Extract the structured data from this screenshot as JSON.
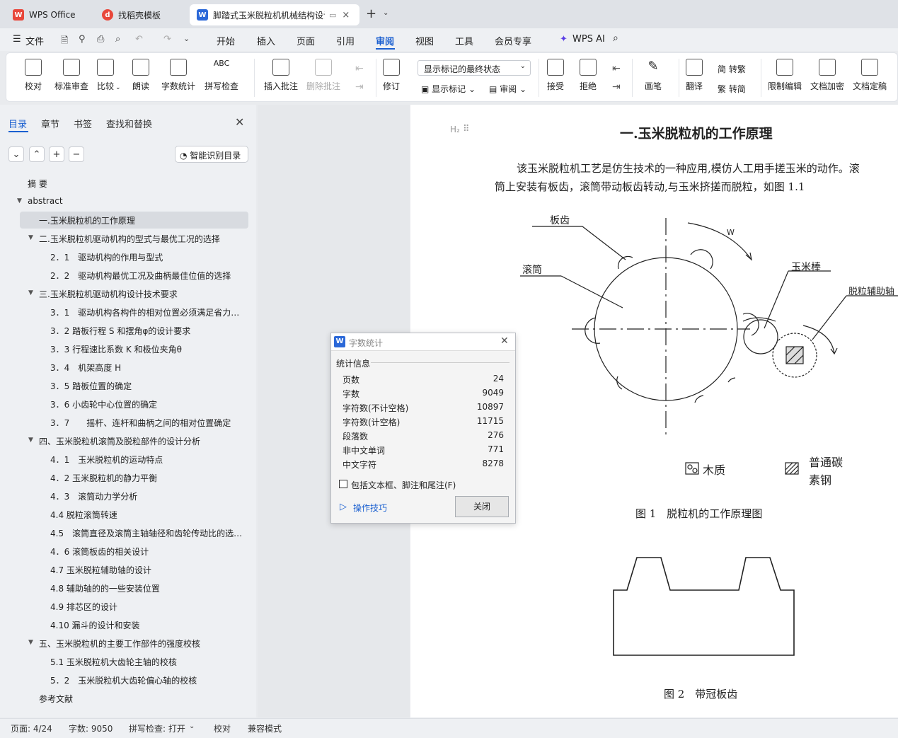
{
  "titlebar": {
    "tabs": [
      {
        "label": "WPS Office"
      },
      {
        "label": "找稻壳模板"
      },
      {
        "label": "脚踏式玉米脱粒机机械结构设计"
      }
    ],
    "new_tab": "+"
  },
  "menubar": {
    "file": "文件",
    "items": [
      "开始",
      "插入",
      "页面",
      "引用",
      "审阅",
      "视图",
      "工具",
      "会员专享"
    ],
    "active": "审阅",
    "ai": "WPS AI"
  },
  "ribbon": {
    "proof": "校对",
    "standard_review": "标准审查",
    "compare": "比较",
    "read_aloud": "朗读",
    "word_count": "字数统计",
    "spell_check": "拼写检查",
    "insert_comment": "插入批注",
    "delete_comment": "删除批注",
    "revise": "修订",
    "markup_state": "显示标记的最终状态",
    "show_markup": "显示标记",
    "review": "审阅",
    "accept": "接受",
    "reject": "拒绝",
    "pen": "画笔",
    "translate": "翻译",
    "to_trad": "简 转繁",
    "to_simp": "繁 转简",
    "restrict_edit": "限制编辑",
    "doc_encrypt": "文档加密",
    "doc_finalize": "文档定稿"
  },
  "navpane": {
    "tabs": [
      "目录",
      "章节",
      "书签",
      "查找和替换"
    ],
    "smart_toc": "智能识别目录",
    "toc": [
      {
        "label": "摘  要",
        "level": 0
      },
      {
        "label": "abstract",
        "level": 0
      },
      {
        "label": "一.玉米脱粒机的工作原理",
        "level": 1
      },
      {
        "label": "二.玉米脱粒机驱动机构的型式与最优工况的选择",
        "level": 1
      },
      {
        "label": "2．1　驱动机构的作用与型式",
        "level": 2
      },
      {
        "label": "2．2　驱动机构最优工况及曲柄最佳位值的选择",
        "level": 2
      },
      {
        "label": "三.玉米脱粒机驱动机构设计技术要求",
        "level": 1
      },
      {
        "label": "3．1　驱动机构各构件的相对位置必须满足省力…",
        "level": 2
      },
      {
        "label": "3．2 踏板行程 S 和摆角φ的设计要求",
        "level": 2
      },
      {
        "label": "3．3 行程速比系数 K 和极位夹角θ",
        "level": 2
      },
      {
        "label": "3．4　机架高度 H",
        "level": 2
      },
      {
        "label": "3．5 踏板位置的确定",
        "level": 2
      },
      {
        "label": "3．6 小齿轮中心位置的确定",
        "level": 2
      },
      {
        "label": "3．7　　摇杆、连杆和曲柄之间的相对位置确定",
        "level": 2
      },
      {
        "label": "四、玉米脱粒机滚筒及脱粒部件的设计分析",
        "level": 1
      },
      {
        "label": "4．1　玉米脱粒机的运动特点",
        "level": 2
      },
      {
        "label": "4．2 玉米脱粒机的静力平衡",
        "level": 2
      },
      {
        "label": "4．3　滚筒动力学分析",
        "level": 2
      },
      {
        "label": "4.4 脱粒滚筒转速",
        "level": 2
      },
      {
        "label": "4.5　滚筒直径及滚筒主轴轴径和齿轮传动比的选…",
        "level": 2
      },
      {
        "label": "4．6 滚筒板齿的相关设计",
        "level": 2
      },
      {
        "label": "4.7 玉米脱粒辅助轴的设计",
        "level": 2
      },
      {
        "label": "4.8 辅助轴的的一些安装位置",
        "level": 2
      },
      {
        "label": "4.9 排芯区的设计",
        "level": 2
      },
      {
        "label": "4.10 漏斗的设计和安装",
        "level": 2
      },
      {
        "label": "五、玉米脱粒机的主要工作部件的强度校核",
        "level": 1
      },
      {
        "label": "5.1 玉米脱粒机大齿轮主轴的校核",
        "level": 2
      },
      {
        "label": "5．2　玉米脱粒机大齿轮偏心轴的校核",
        "level": 2
      },
      {
        "label": "参考文献",
        "level": 1
      }
    ]
  },
  "document": {
    "heading_marker": "H₂",
    "heading": "一.玉米脱粒机的工作原理",
    "para1": "该玉米脱粒机工艺是仿生技术的一种应用,模仿人工用手搓玉米的动作。滚",
    "para2": "筒上安装有板齿，滚筒带动板齿转动,与玉米挤搓而脱粒，如图 1.1",
    "fig1": {
      "plate_tooth": "板齿",
      "drum": "滚筒",
      "w": "W",
      "corn": "玉米棒",
      "aux_shaft": "脱粒辅助轴",
      "legend_wood": "木质",
      "legend_steel1": "普通碳",
      "legend_steel2": "素钢"
    },
    "fig1_caption": "图 1　脱粒机的工作原理图",
    "fig2_caption": "图 2　带冠板齿"
  },
  "dialog": {
    "title": "字数统计",
    "section": "统计信息",
    "rows": [
      {
        "label": "页数",
        "value": "24"
      },
      {
        "label": "字数",
        "value": "9049"
      },
      {
        "label": "字符数(不计空格)",
        "value": "10897"
      },
      {
        "label": "字符数(计空格)",
        "value": "11715"
      },
      {
        "label": "段落数",
        "value": "276"
      },
      {
        "label": "非中文单词",
        "value": "771"
      },
      {
        "label": "中文字符",
        "value": "8278"
      }
    ],
    "checkbox": "包括文本框、脚注和尾注(F)",
    "tips": "操作技巧",
    "close": "关闭"
  },
  "statusbar": {
    "page": "页面: 4/24",
    "words": "字数: 9050",
    "spell": "拼写检查: 打开",
    "proof": "校对",
    "compat": "兼容模式"
  },
  "colors": {
    "accent": "#1a5fd0",
    "wps_red": "#e8473b",
    "doc_blue": "#2b68d8"
  }
}
